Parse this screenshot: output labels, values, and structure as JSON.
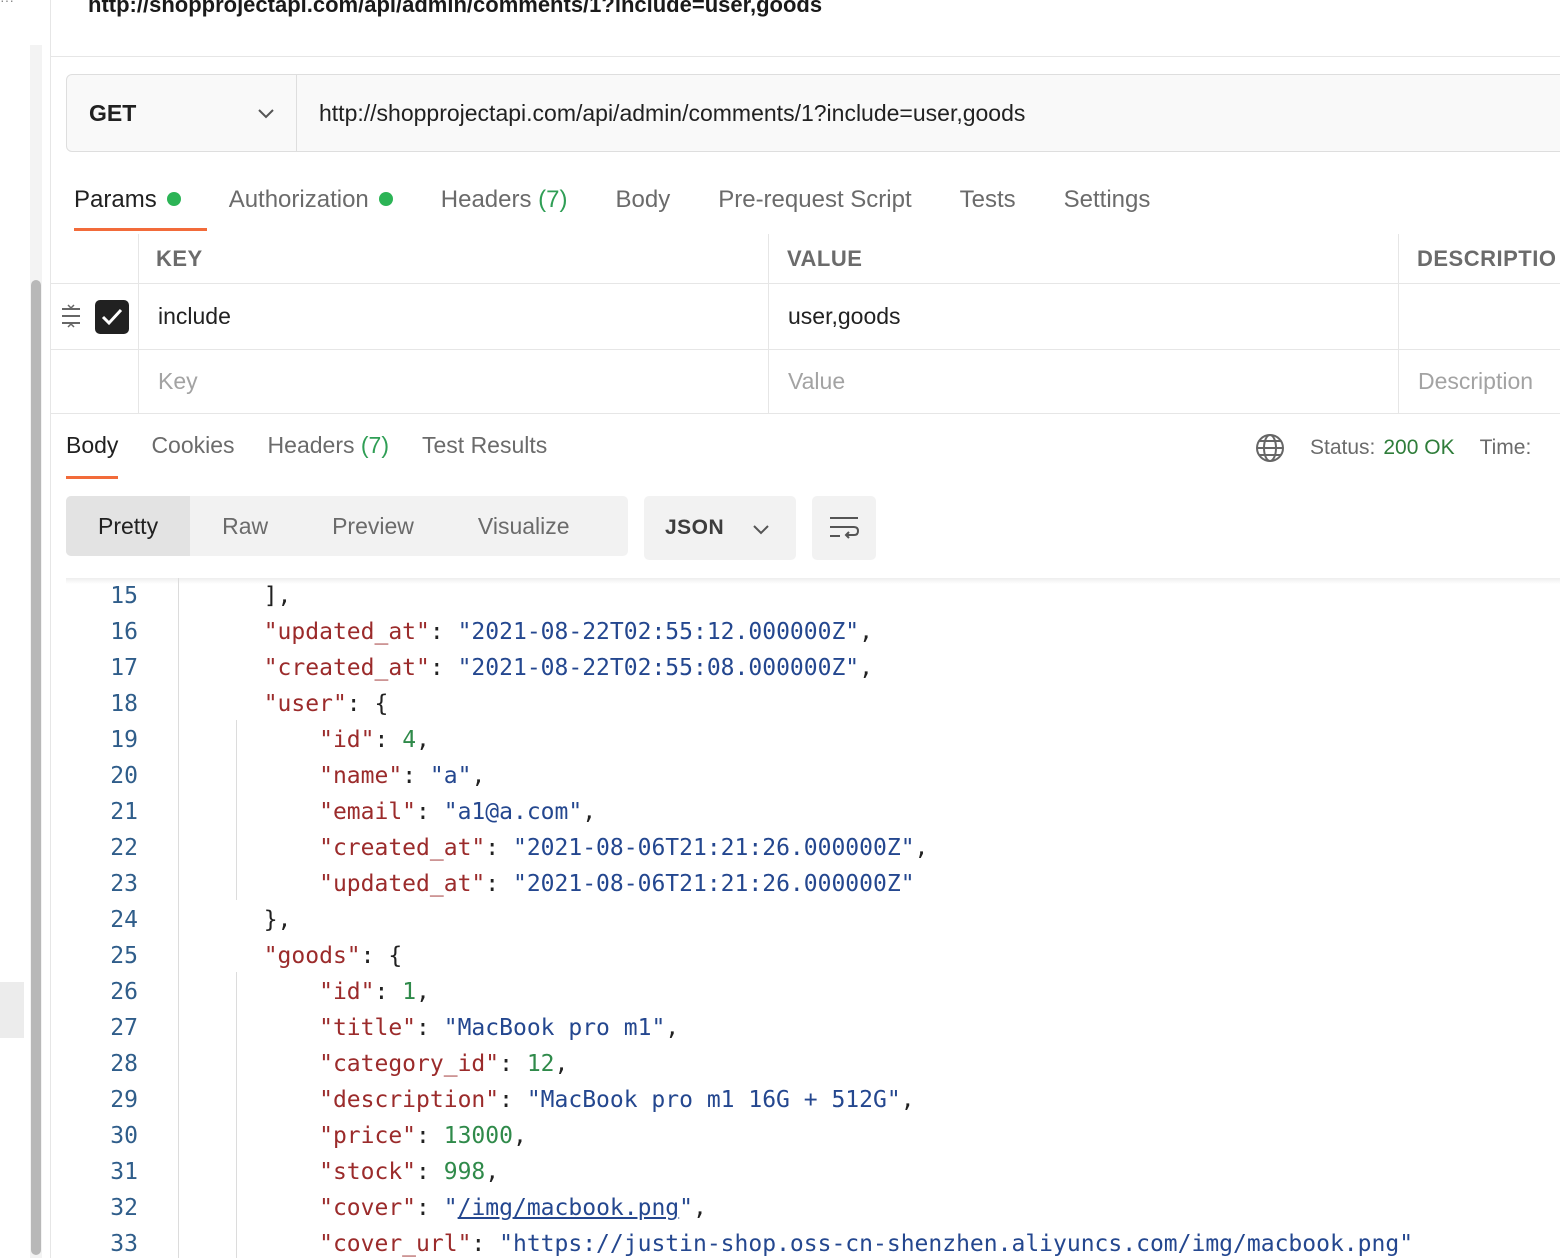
{
  "request": {
    "title": "http://shopprojectapi.com/api/admin/comments/1?include=user,goods",
    "method": "GET",
    "url": "http://shopprojectapi.com/api/admin/comments/1?include=user,goods"
  },
  "request_tabs": [
    {
      "label": "Params",
      "dot": true,
      "active": true
    },
    {
      "label": "Authorization",
      "dot": true
    },
    {
      "label": "Headers",
      "count": "(7)"
    },
    {
      "label": "Body"
    },
    {
      "label": "Pre-request Script"
    },
    {
      "label": "Tests"
    },
    {
      "label": "Settings"
    }
  ],
  "params": {
    "headers": {
      "key": "KEY",
      "value": "VALUE",
      "description": "DESCRIPTIO"
    },
    "rows": [
      {
        "key": "include",
        "value": "user,goods",
        "checked": true
      }
    ],
    "placeholders": {
      "key": "Key",
      "value": "Value",
      "description": "Description"
    }
  },
  "response": {
    "tabs": [
      {
        "label": "Body",
        "active": true
      },
      {
        "label": "Cookies"
      },
      {
        "label": "Headers",
        "count": "(7)"
      },
      {
        "label": "Test Results"
      }
    ],
    "status_label": "Status:",
    "status_value": "200 OK",
    "time_label": "Time:",
    "view_modes": [
      "Pretty",
      "Raw",
      "Preview",
      "Visualize"
    ],
    "active_view": "Pretty",
    "format": "JSON"
  },
  "code_lines": [
    {
      "n": "15",
      "indent": 1,
      "parts": [
        [
          "p",
          "],"
        ]
      ]
    },
    {
      "n": "16",
      "indent": 1,
      "parts": [
        [
          "k",
          "\"updated_at\""
        ],
        [
          "p",
          ": "
        ],
        [
          "s",
          "\"2021-08-22T02:55:12.000000Z\""
        ],
        [
          "p",
          ","
        ]
      ]
    },
    {
      "n": "17",
      "indent": 1,
      "parts": [
        [
          "k",
          "\"created_at\""
        ],
        [
          "p",
          ": "
        ],
        [
          "s",
          "\"2021-08-22T02:55:08.000000Z\""
        ],
        [
          "p",
          ","
        ]
      ]
    },
    {
      "n": "18",
      "indent": 1,
      "parts": [
        [
          "k",
          "\"user\""
        ],
        [
          "p",
          ": {"
        ]
      ]
    },
    {
      "n": "19",
      "indent": 2,
      "parts": [
        [
          "k",
          "\"id\""
        ],
        [
          "p",
          ": "
        ],
        [
          "n",
          "4"
        ],
        [
          "p",
          ","
        ]
      ]
    },
    {
      "n": "20",
      "indent": 2,
      "parts": [
        [
          "k",
          "\"name\""
        ],
        [
          "p",
          ": "
        ],
        [
          "s",
          "\"a\""
        ],
        [
          "p",
          ","
        ]
      ]
    },
    {
      "n": "21",
      "indent": 2,
      "parts": [
        [
          "k",
          "\"email\""
        ],
        [
          "p",
          ": "
        ],
        [
          "s",
          "\"a1@a.com\""
        ],
        [
          "p",
          ","
        ]
      ]
    },
    {
      "n": "22",
      "indent": 2,
      "parts": [
        [
          "k",
          "\"created_at\""
        ],
        [
          "p",
          ": "
        ],
        [
          "s",
          "\"2021-08-06T21:21:26.000000Z\""
        ],
        [
          "p",
          ","
        ]
      ]
    },
    {
      "n": "23",
      "indent": 2,
      "parts": [
        [
          "k",
          "\"updated_at\""
        ],
        [
          "p",
          ": "
        ],
        [
          "s",
          "\"2021-08-06T21:21:26.000000Z\""
        ]
      ]
    },
    {
      "n": "24",
      "indent": 1,
      "parts": [
        [
          "p",
          "},"
        ]
      ]
    },
    {
      "n": "25",
      "indent": 1,
      "parts": [
        [
          "k",
          "\"goods\""
        ],
        [
          "p",
          ": {"
        ]
      ]
    },
    {
      "n": "26",
      "indent": 2,
      "parts": [
        [
          "k",
          "\"id\""
        ],
        [
          "p",
          ": "
        ],
        [
          "n",
          "1"
        ],
        [
          "p",
          ","
        ]
      ]
    },
    {
      "n": "27",
      "indent": 2,
      "parts": [
        [
          "k",
          "\"title\""
        ],
        [
          "p",
          ": "
        ],
        [
          "s",
          "\"MacBook pro m1\""
        ],
        [
          "p",
          ","
        ]
      ]
    },
    {
      "n": "28",
      "indent": 2,
      "parts": [
        [
          "k",
          "\"category_id\""
        ],
        [
          "p",
          ": "
        ],
        [
          "n",
          "12"
        ],
        [
          "p",
          ","
        ]
      ]
    },
    {
      "n": "29",
      "indent": 2,
      "parts": [
        [
          "k",
          "\"description\""
        ],
        [
          "p",
          ": "
        ],
        [
          "s",
          "\"MacBook pro m1 16G + 512G\""
        ],
        [
          "p",
          ","
        ]
      ]
    },
    {
      "n": "30",
      "indent": 2,
      "parts": [
        [
          "k",
          "\"price\""
        ],
        [
          "p",
          ": "
        ],
        [
          "n",
          "13000"
        ],
        [
          "p",
          ","
        ]
      ]
    },
    {
      "n": "31",
      "indent": 2,
      "parts": [
        [
          "k",
          "\"stock\""
        ],
        [
          "p",
          ": "
        ],
        [
          "n",
          "998"
        ],
        [
          "p",
          ","
        ]
      ]
    },
    {
      "n": "32",
      "indent": 2,
      "parts": [
        [
          "k",
          "\"cover\""
        ],
        [
          "p",
          ": "
        ],
        [
          "s",
          "\""
        ],
        [
          "l",
          "/img/macbook.png"
        ],
        [
          "s",
          "\""
        ],
        [
          "p",
          ","
        ]
      ]
    },
    {
      "n": "33",
      "indent": 2,
      "parts": [
        [
          "k",
          "\"cover_url\""
        ],
        [
          "p",
          ": "
        ],
        [
          "s",
          "\"https://justin-shop.oss-cn-shenzhen.aliyuncs.com/img/macbook.png\""
        ]
      ]
    }
  ],
  "colors": {
    "accent": "#f26b3a",
    "dot_green": "#2cb456",
    "status_green": "#2f7d3a",
    "json_key": "#9b2b2b",
    "json_string": "#24478f",
    "json_number": "#2f8a4a"
  },
  "icons": [
    "chevron-down-icon",
    "drag-handle-icon",
    "checkbox-checked-icon",
    "globe-icon",
    "wrap-lines-icon"
  ]
}
